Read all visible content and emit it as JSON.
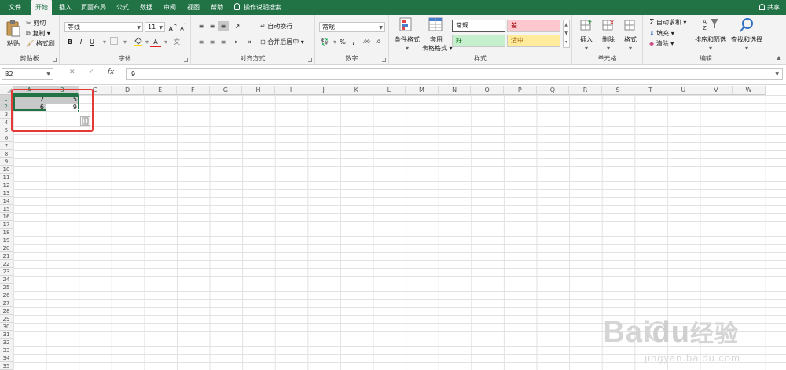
{
  "tabs": [
    {
      "label": "文件",
      "active": false
    },
    {
      "label": "开始",
      "active": true
    },
    {
      "label": "插入",
      "active": false
    },
    {
      "label": "页面布局",
      "active": false
    },
    {
      "label": "公式",
      "active": false
    },
    {
      "label": "数据",
      "active": false
    },
    {
      "label": "审阅",
      "active": false
    },
    {
      "label": "视图",
      "active": false
    },
    {
      "label": "帮助",
      "active": false
    }
  ],
  "tell_me": "操作说明搜索",
  "share": "共享",
  "ribbon": {
    "clipboard": {
      "label": "剪贴板",
      "paste": "粘贴",
      "cut": "剪切",
      "copy": "复制",
      "format_painter": "格式刷"
    },
    "font": {
      "label": "字体",
      "font_name": "等线",
      "font_size": "11",
      "bold": "B",
      "italic": "I",
      "underline": "U",
      "grow": "A",
      "shrink": "A",
      "font_color": "A"
    },
    "alignment": {
      "label": "对齐方式",
      "wrap_text": "自动换行",
      "merge_center": "合并后居中"
    },
    "number": {
      "label": "数字",
      "format": "常规",
      "percent": "%",
      "comma": ","
    },
    "styles": {
      "label": "样式",
      "conditional": "条件格式",
      "table": "套用",
      "table2": "表格格式",
      "normal": "常规",
      "bad": "差",
      "good": "好",
      "neutral": "适中"
    },
    "cells": {
      "label": "单元格",
      "insert": "插入",
      "delete": "删除",
      "format": "格式"
    },
    "editing": {
      "label": "编辑",
      "autosum": "自动求和",
      "fill": "填充",
      "clear": "清除",
      "sort_filter": "排序和筛选",
      "find_select": "查找和选择"
    }
  },
  "formula_bar": {
    "name_box": "B2",
    "formula": "9",
    "fx": "fx",
    "cancel": "✕",
    "enter": "✓"
  },
  "columns": [
    "A",
    "B",
    "C",
    "D",
    "E",
    "F",
    "G",
    "H",
    "I",
    "J",
    "K",
    "L",
    "M",
    "N",
    "O",
    "P",
    "Q",
    "R",
    "S",
    "T",
    "U",
    "V",
    "W"
  ],
  "rows": [
    "1",
    "2",
    "3",
    "4",
    "5",
    "6",
    "7",
    "8",
    "9",
    "10",
    "11",
    "12",
    "13",
    "14",
    "15",
    "16",
    "17",
    "18",
    "19",
    "20",
    "21",
    "22",
    "23",
    "24",
    "25",
    "26",
    "27",
    "28",
    "29",
    "30",
    "31",
    "32",
    "33",
    "34",
    "35"
  ],
  "cells": {
    "A1": "2",
    "B1": "5",
    "A2": "6",
    "B2": "9"
  },
  "watermark": {
    "brand": "Bai",
    "brand2": "du",
    "brand3": "经验",
    "url": "jingyan.baidu.com"
  },
  "colors": {
    "accent": "#217346",
    "highlight": "#e53935",
    "bad_bg": "#ffc7ce",
    "good_bg": "#c6efce",
    "neutral_bg": "#ffeb9c"
  }
}
